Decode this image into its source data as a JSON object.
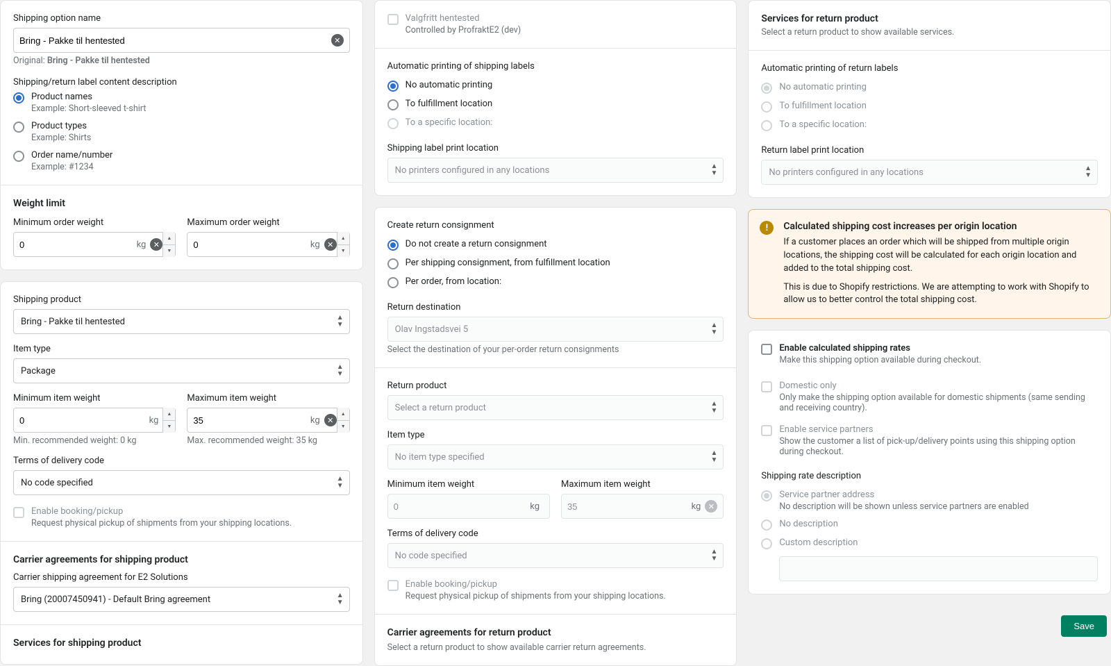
{
  "col1": {
    "option_name_label": "Shipping option name",
    "option_name_value": "Bring - Pakke til hentested",
    "original_prefix": "Original: ",
    "original_value": "Bring - Pakke til hentested",
    "label_content_heading": "Shipping/return label content description",
    "label_options": {
      "product_names": {
        "label": "Product names",
        "example": "Example: Short-sleeved t-shirt"
      },
      "product_types": {
        "label": "Product types",
        "example": "Example: Shirts"
      },
      "order_name": {
        "label": "Order name/number",
        "example": "Example: #1234"
      }
    },
    "weight_limit_heading": "Weight limit",
    "min_order_weight_label": "Minimum order weight",
    "max_order_weight_label": "Maximum order weight",
    "min_order_weight_value": "0",
    "max_order_weight_value": "0",
    "kg": "kg",
    "shipping_product_label": "Shipping product",
    "shipping_product_value": "Bring - Pakke til hentested",
    "item_type_label": "Item type",
    "item_type_value": "Package",
    "min_item_weight_label": "Minimum item weight",
    "max_item_weight_label": "Maximum item weight",
    "min_item_weight_value": "0",
    "max_item_weight_value": "35",
    "min_item_help": "Min. recommended weight: 0 kg",
    "max_item_help": "Max. recommended weight: 35 kg",
    "delivery_code_label": "Terms of delivery code",
    "delivery_code_value": "No code specified",
    "enable_booking_label": "Enable booking/pickup",
    "enable_booking_help": "Request physical pickup of shipments from your shipping locations.",
    "carrier_agreements_heading": "Carrier agreements for shipping product",
    "carrier_agreement_label": "Carrier shipping agreement for E2 Solutions",
    "carrier_agreement_value": "Bring (20007450941) - Default Bring agreement",
    "services_heading": "Services for shipping product"
  },
  "col2": {
    "valgfritt_label": "Valgfritt hentested",
    "valgfritt_help": "Controlled by ProfraktE2 (dev)",
    "auto_print_heading": "Automatic printing of shipping labels",
    "auto_print_options": {
      "none": "No automatic printing",
      "fulfillment": "To fulfillment location",
      "specific": "To a specific location:"
    },
    "print_location_label": "Shipping label print location",
    "print_location_value": "No printers configured in any locations",
    "return_consignment_heading": "Create return consignment",
    "return_consignment_options": {
      "none": "Do not create a return consignment",
      "per_shipping": "Per shipping consignment, from fulfillment location",
      "per_order": "Per order, from location:"
    },
    "return_dest_label": "Return destination",
    "return_dest_value": "Olav Ingstadsvei 5",
    "return_dest_help": "Select the destination of your per-order return consignments",
    "return_product_label": "Return product",
    "return_product_value": "Select a return product",
    "r_item_type_label": "Item type",
    "r_item_type_value": "No item type specified",
    "r_min_item_label": "Minimum item weight",
    "r_max_item_label": "Maximum item weight",
    "r_min_item_value": "0",
    "r_max_item_value": "35",
    "r_delivery_code_label": "Terms of delivery code",
    "r_delivery_code_value": "No code specified",
    "r_enable_booking_label": "Enable booking/pickup",
    "r_enable_booking_help": "Request physical pickup of shipments from your shipping locations.",
    "r_carrier_heading": "Carrier agreements for return product",
    "r_carrier_help": "Select a return product to show available carrier return agreements."
  },
  "col3": {
    "services_heading": "Services for return product",
    "services_help": "Select a return product to show available services.",
    "auto_print_heading": "Automatic printing of return labels",
    "auto_print_options": {
      "none": "No automatic printing",
      "fulfillment": "To fulfillment location",
      "specific": "To a specific location:"
    },
    "print_location_label": "Return label print location",
    "print_location_value": "No printers configured in any locations",
    "banner_title": "Calculated shipping cost increases per origin location",
    "banner_p1": "If a customer places an order which will be shipped from multiple origin locations, the shipping cost will be calculated for each origin location and added to the total shipping cost.",
    "banner_p2": "This is due to Shopify restrictions. We are attempting to work with Shopify to allow us to better control the total shipping cost.",
    "enable_calc_label": "Enable calculated shipping rates",
    "enable_calc_help": "Make this shipping option available during checkout.",
    "domestic_label": "Domestic only",
    "domestic_help": "Only make the shipping option available for domestic shipments (same sending and receiving country).",
    "service_partners_label": "Enable service partners",
    "service_partners_help": "Show the customer a list of pick-up/delivery points using this shipping option during checkout.",
    "rate_desc_heading": "Shipping rate description",
    "rate_options": {
      "partner": "Service partner address",
      "partner_help": "No description will be shown unless service partners are enabled",
      "none": "No description",
      "custom": "Custom description"
    },
    "save": "Save"
  }
}
